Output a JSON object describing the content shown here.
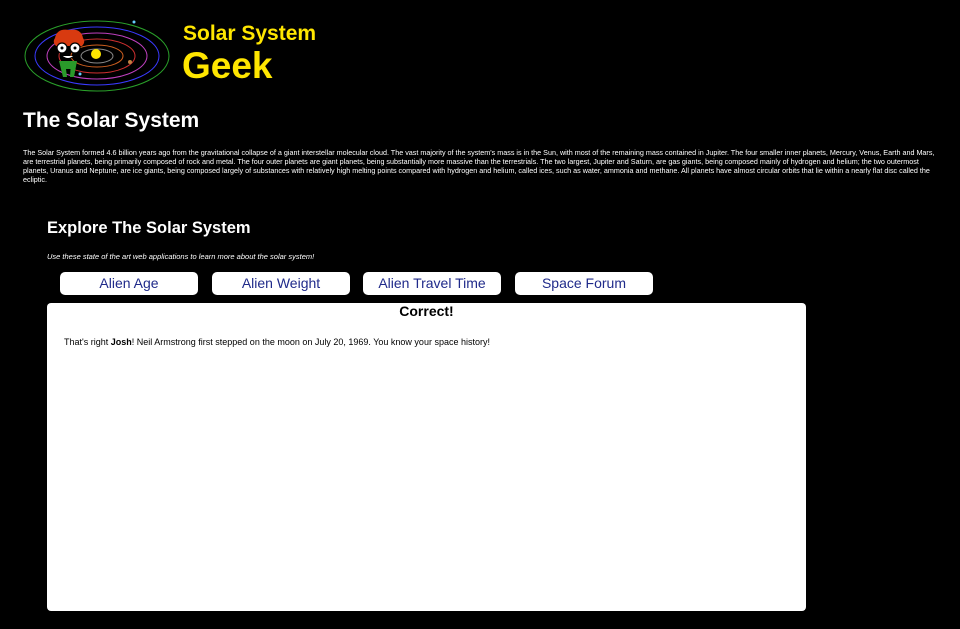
{
  "brand": {
    "line1": "Solar System",
    "line2": "Geek",
    "color": "#ffe600"
  },
  "logo": {
    "icon": "solar-system-geek-logo"
  },
  "page": {
    "title": "The Solar System",
    "intro": "The Solar System formed 4.6 billion years ago from the gravitational collapse of a giant interstellar molecular cloud. The vast majority of the system's mass is in the Sun, with most of the remaining mass contained in Jupiter. The four smaller inner planets, Mercury, Venus, Earth and Mars, are terrestrial planets, being primarily composed of rock and metal. The four outer planets are giant planets, being substantially more massive than the terrestrials. The two largest, Jupiter and Saturn, are gas giants, being composed mainly of hydrogen and helium; the two outermost planets, Uranus and Neptune, are ice giants, being composed largely of substances with relatively high melting points compared with hydrogen and helium, called ices, such as water, ammonia and methane. All planets have almost circular orbits that lie within a nearly flat disc called the ecliptic."
  },
  "explore": {
    "title": "Explore The Solar System",
    "subtitle": "Use these state of the art web applications to learn more about the solar system!"
  },
  "tabs": [
    {
      "label": "Alien Age"
    },
    {
      "label": "Alien Weight"
    },
    {
      "label": "Alien Travel Time"
    },
    {
      "label": "Space Forum"
    }
  ],
  "panel": {
    "title": "Correct!",
    "msg_prefix": "That's right ",
    "user_name": "Josh",
    "msg_suffix": "! Neil Armstrong first stepped on the moon on July 20, 1969. You know your space history!"
  },
  "colors": {
    "background": "#000000",
    "tab_text": "#1f2a8a",
    "panel_bg": "#ffffff"
  }
}
